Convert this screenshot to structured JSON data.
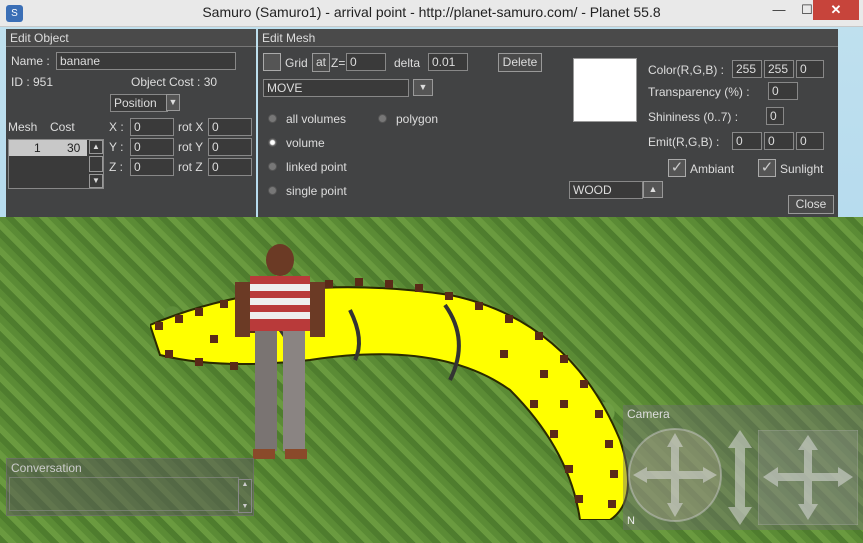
{
  "window": {
    "title": "Samuro (Samuro1) - arrival point - http://planet-samuro.com/ - Planet 55.8",
    "minimize_glyph": "—",
    "maximize_glyph": "☐",
    "close_glyph": "✕"
  },
  "edit_object": {
    "header": "Edit Object",
    "name_label": "Name :",
    "name_value": "banane",
    "id_text": "ID : 951",
    "cost_text": "Object Cost : 30",
    "mode_select": "Position",
    "mesh_col": "Mesh",
    "cost_col": "Cost",
    "mesh_row": {
      "mesh": "1",
      "cost": "30"
    },
    "x_label": "X :",
    "x_value": "0",
    "y_label": "Y :",
    "y_value": "0",
    "z_label": "Z :",
    "z_value": "0",
    "rotx_label": "rot X",
    "rotx_value": "0",
    "roty_label": "rot Y",
    "roty_value": "0",
    "rotz_label": "rot Z",
    "rotz_value": "0"
  },
  "edit_mesh": {
    "header": "Edit Mesh",
    "grid_label": "Grid",
    "at_label": "at",
    "z_label": "Z=",
    "z_value": "0",
    "delta_label": "delta",
    "delta_value": "0.01",
    "delete_label": "Delete",
    "mode_select": "MOVE",
    "radios": [
      {
        "label": "all volumes",
        "selected": false
      },
      {
        "label": "volume",
        "selected": true
      },
      {
        "label": "linked point",
        "selected": false
      },
      {
        "label": "single point",
        "selected": false
      }
    ],
    "polygon_label": "polygon",
    "color_label": "Color(R,G,B) :",
    "color_r": "255",
    "color_g": "255",
    "color_b": "0",
    "transparency_label": "Transparency (%) :",
    "transparency_value": "0",
    "shininess_label": "Shininess (0..7) :",
    "shininess_value": "0",
    "emit_label": "Emit(R,G,B) :",
    "emit_r": "0",
    "emit_g": "0",
    "emit_b": "0",
    "ambiant_label": "Ambiant",
    "ambiant_checked": true,
    "sunlight_label": "Sunlight",
    "sunlight_checked": true,
    "material_select": "WOOD",
    "close_label": "Close",
    "swatch_color": "#ffffff"
  },
  "conversation": {
    "header": "Conversation"
  },
  "camera": {
    "header": "Camera",
    "compass_label": "N"
  },
  "colors": {
    "banana": "#ffff00",
    "panel_bg": "#3e3e3e",
    "close_btn": "#c7443b"
  }
}
